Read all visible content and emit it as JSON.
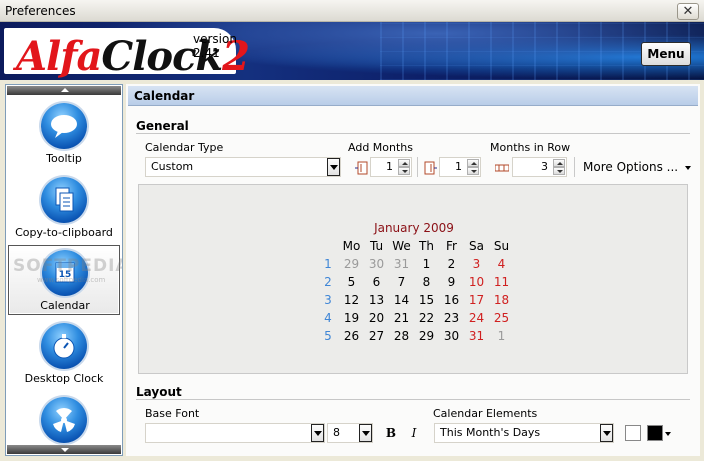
{
  "window": {
    "title": "Preferences",
    "close_glyph": "✕"
  },
  "banner": {
    "logo": {
      "alfa": "Alfa",
      "clock": "Clock",
      "num": "2"
    },
    "version": "version 2.41",
    "menu_label": "Menu"
  },
  "sidebar": {
    "items": [
      {
        "label": "Tooltip",
        "icon": "speech-bubble-icon"
      },
      {
        "label": "Copy-to-clipboard",
        "icon": "clipboard-icon"
      },
      {
        "label": "Calendar",
        "icon": "calendar-icon",
        "active": true,
        "icon_text": "15"
      },
      {
        "label": "Desktop Clock",
        "icon": "stopwatch-icon"
      },
      {
        "label": "",
        "icon": "radiation-icon"
      }
    ],
    "watermark": "SOFTPEDIA",
    "watermark_small": "www.softpedia.com"
  },
  "panel": {
    "header": "Calendar",
    "general": {
      "title": "General",
      "calendar_type_label": "Calendar Type",
      "calendar_type_value": "Custom",
      "add_months_label": "Add Months",
      "add_months_before": "1",
      "add_months_after": "1",
      "months_in_row_label": "Months in Row",
      "months_in_row_value": "3",
      "more_options_label": "More Options ..."
    },
    "calendar": {
      "title": "January 2009",
      "headers": [
        "Mo",
        "Tu",
        "We",
        "Th",
        "Fr",
        "Sa",
        "Su"
      ],
      "weeks": [
        {
          "wk": "1",
          "days": [
            "29",
            "30",
            "31",
            "1",
            "2",
            "3",
            "4"
          ]
        },
        {
          "wk": "2",
          "days": [
            "5",
            "6",
            "7",
            "8",
            "9",
            "10",
            "11"
          ]
        },
        {
          "wk": "3",
          "days": [
            "12",
            "13",
            "14",
            "15",
            "16",
            "17",
            "18"
          ]
        },
        {
          "wk": "4",
          "days": [
            "19",
            "20",
            "21",
            "22",
            "23",
            "24",
            "25"
          ]
        },
        {
          "wk": "5",
          "days": [
            "26",
            "27",
            "28",
            "29",
            "30",
            "31",
            "1"
          ]
        }
      ],
      "colors": {
        "title": "#8b1016",
        "week_number": "#3f86d6",
        "weekend": "#d02020",
        "other_month": "#9a9a9a"
      }
    },
    "layout": {
      "title": "Layout",
      "base_font_label": "Base Font",
      "base_font_value": "",
      "font_size_value": "8",
      "bold_label": "B",
      "italic_label": "I",
      "calendar_elements_label": "Calendar Elements",
      "calendar_elements_value": "This Month's Days",
      "background_color": "#ffffff",
      "text_color": "#000000"
    }
  }
}
